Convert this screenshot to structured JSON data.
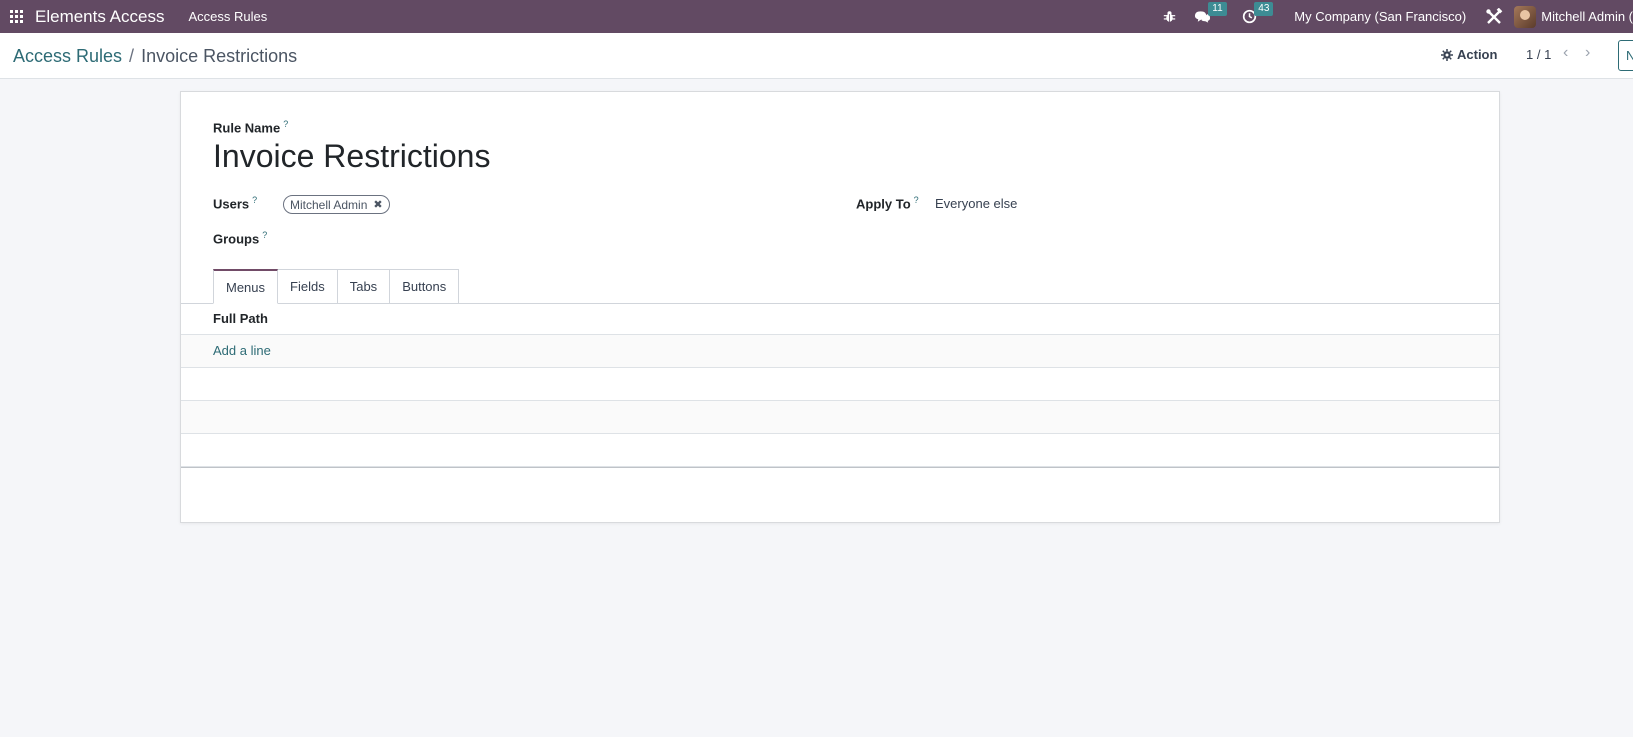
{
  "navbar": {
    "app_name": "Elements Access",
    "menu_item": "Access Rules",
    "messages_count": "11",
    "activities_count": "43",
    "company": "My Company (San Francisco)",
    "user_name": "Mitchell Admin (",
    "bg_color": "#624a63"
  },
  "control_panel": {
    "breadcrumb_parent": "Access Rules",
    "breadcrumb_separator": "/",
    "breadcrumb_current": "Invoice Restrictions",
    "action_label": "Action",
    "pager": "1 / 1",
    "new_label": "N"
  },
  "form": {
    "rule_name_label": "Rule Name",
    "rule_name_value": "Invoice Restrictions",
    "users_label": "Users",
    "users_tags": [
      "Mitchell Admin"
    ],
    "groups_label": "Groups",
    "apply_to_label": "Apply To",
    "apply_to_value": "Everyone else",
    "tooltip_marker": "?"
  },
  "tabs": [
    "Menus",
    "Fields",
    "Tabs",
    "Buttons"
  ],
  "active_tab": "Menus",
  "table": {
    "column_header": "Full Path",
    "add_line_label": "Add a line"
  }
}
